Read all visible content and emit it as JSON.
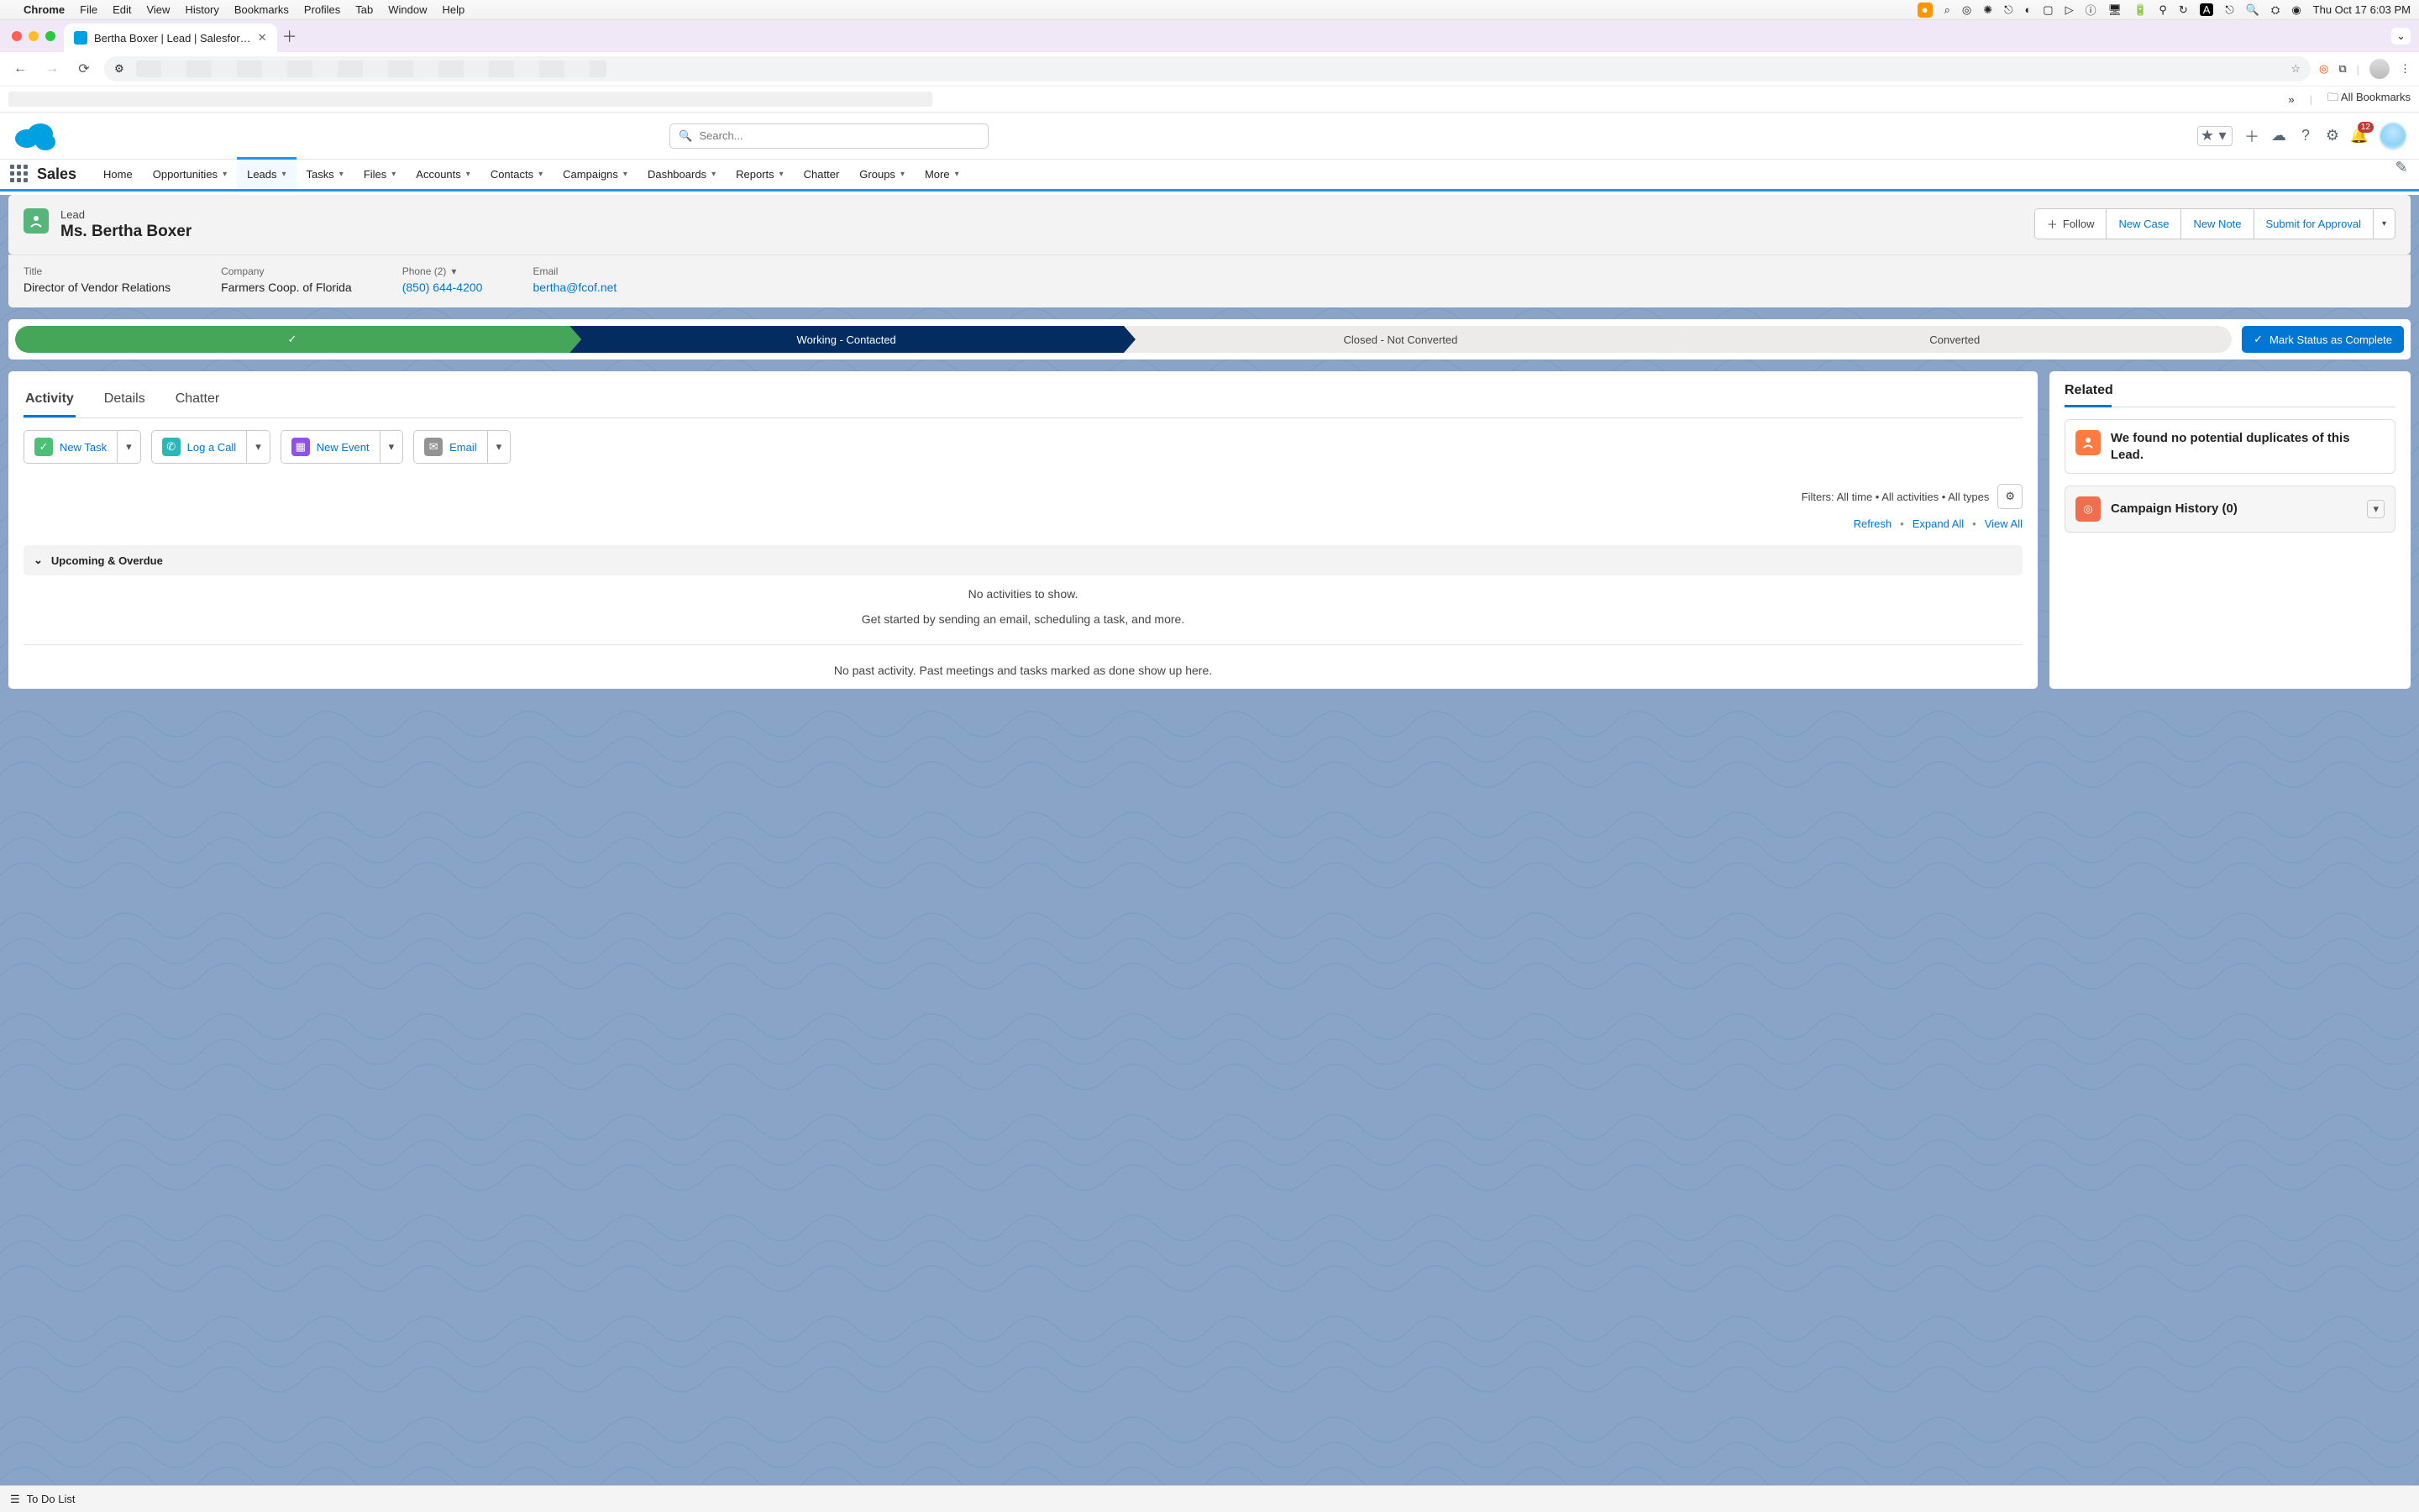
{
  "menubar": {
    "app": "Chrome",
    "items": [
      "File",
      "Edit",
      "View",
      "History",
      "Bookmarks",
      "Profiles",
      "Tab",
      "Window",
      "Help"
    ],
    "clock": "Thu Oct 17  6:03 PM"
  },
  "chrome": {
    "tab_title": "Bertha Boxer | Lead | Salesfor…",
    "all_bookmarks": "All Bookmarks"
  },
  "sf_header": {
    "search_placeholder": "Search...",
    "notifications": "12"
  },
  "sf_nav": {
    "app": "Sales",
    "tabs": [
      "Home",
      "Opportunities",
      "Leads",
      "Tasks",
      "Files",
      "Accounts",
      "Contacts",
      "Campaigns",
      "Dashboards",
      "Reports",
      "Chatter",
      "Groups",
      "More"
    ],
    "active": "Leads"
  },
  "record": {
    "object_label": "Lead",
    "name": "Ms. Bertha Boxer",
    "actions": {
      "follow": "Follow",
      "new_case": "New Case",
      "new_note": "New Note",
      "submit": "Submit for Approval"
    },
    "fields": {
      "title_label": "Title",
      "title_value": "Director of Vendor Relations",
      "company_label": "Company",
      "company_value": "Farmers Coop. of Florida",
      "phone_label": "Phone (2)",
      "phone_value": "(850) 644-4200",
      "email_label": "Email",
      "email_value": "bertha@fcof.net"
    }
  },
  "path": {
    "stages": [
      "",
      "Working - Contacted",
      "Closed - Not Converted",
      "Converted"
    ],
    "complete_button": "Mark Status as Complete"
  },
  "activity": {
    "tabs": [
      "Activity",
      "Details",
      "Chatter"
    ],
    "new_task": "New Task",
    "log_call": "Log a Call",
    "new_event": "New Event",
    "email": "Email",
    "filters": "Filters: All time  •  All activities  •  All types",
    "refresh": "Refresh",
    "expand": "Expand All",
    "view_all": "View All",
    "section_upcoming": "Upcoming & Overdue",
    "empty1": "No activities to show.",
    "empty2": "Get started by sending an email, scheduling a task, and more.",
    "empty3": "No past activity. Past meetings and tasks marked as done show up here."
  },
  "related": {
    "heading": "Related",
    "duplicates": "We found no potential duplicates of this Lead.",
    "campaign": "Campaign History (0)"
  },
  "util": {
    "todo": "To Do List"
  }
}
